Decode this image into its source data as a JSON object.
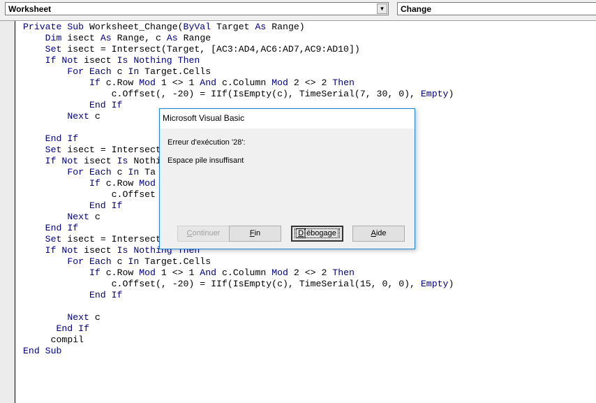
{
  "toolbar": {
    "object_combo": "Worksheet",
    "procedure_combo": "Change"
  },
  "colors": {
    "keyword": "#00007f",
    "dialog_border": "#1883d7"
  },
  "keywords": [
    "Private",
    "Sub",
    "ByVal",
    "As",
    "Dim",
    "Set",
    "If",
    "Not",
    "Is",
    "Nothing",
    "Then",
    "For",
    "Each",
    "In",
    "And",
    "Mod",
    "End",
    "Next",
    "Empty"
  ],
  "code_lines": [
    "Private Sub Worksheet_Change(ByVal Target As Range)",
    "    Dim isect As Range, c As Range",
    "    Set isect = Intersect(Target, [AC3:AD4,AC6:AD7,AC9:AD10])",
    "    If Not isect Is Nothing Then",
    "        For Each c In Target.Cells",
    "            If c.Row Mod 1 <> 1 And c.Column Mod 2 <> 2 Then",
    "                c.Offset(, -20) = IIf(IsEmpty(c), TimeSerial(7, 30, 0), Empty)",
    "            End If",
    "        Next c",
    "",
    "    End If",
    "    Set isect = Intersect",
    "    If Not isect Is Nothi",
    "        For Each c In Ta",
    "            If c.Row Mod",
    "                c.Offset                                       , Empty)",
    "            End If",
    "        Next c",
    "    End If",
    "    Set isect = Intersect",
    "    If Not isect Is Nothing Then",
    "        For Each c In Target.Cells",
    "            If c.Row Mod 1 <> 1 And c.Column Mod 2 <> 2 Then",
    "                c.Offset(, -20) = IIf(IsEmpty(c), TimeSerial(15, 0, 0), Empty)",
    "            End If",
    "",
    "        Next c",
    "      End If",
    "     compil",
    "End Sub"
  ],
  "dialog": {
    "title": "Microsoft Visual Basic",
    "error_line": "Erreur d'exécution '28':",
    "message": "Espace pile insuffisant",
    "buttons": {
      "continue": {
        "mnemonic": "C",
        "rest": "ontinuer",
        "enabled": false
      },
      "end": {
        "mnemonic": "F",
        "rest": "in",
        "enabled": true
      },
      "debug": {
        "mnemonic": "D",
        "rest": "ébogage",
        "enabled": true,
        "default": true
      },
      "help": {
        "mnemonic": "A",
        "rest": "ide",
        "enabled": true
      }
    }
  }
}
